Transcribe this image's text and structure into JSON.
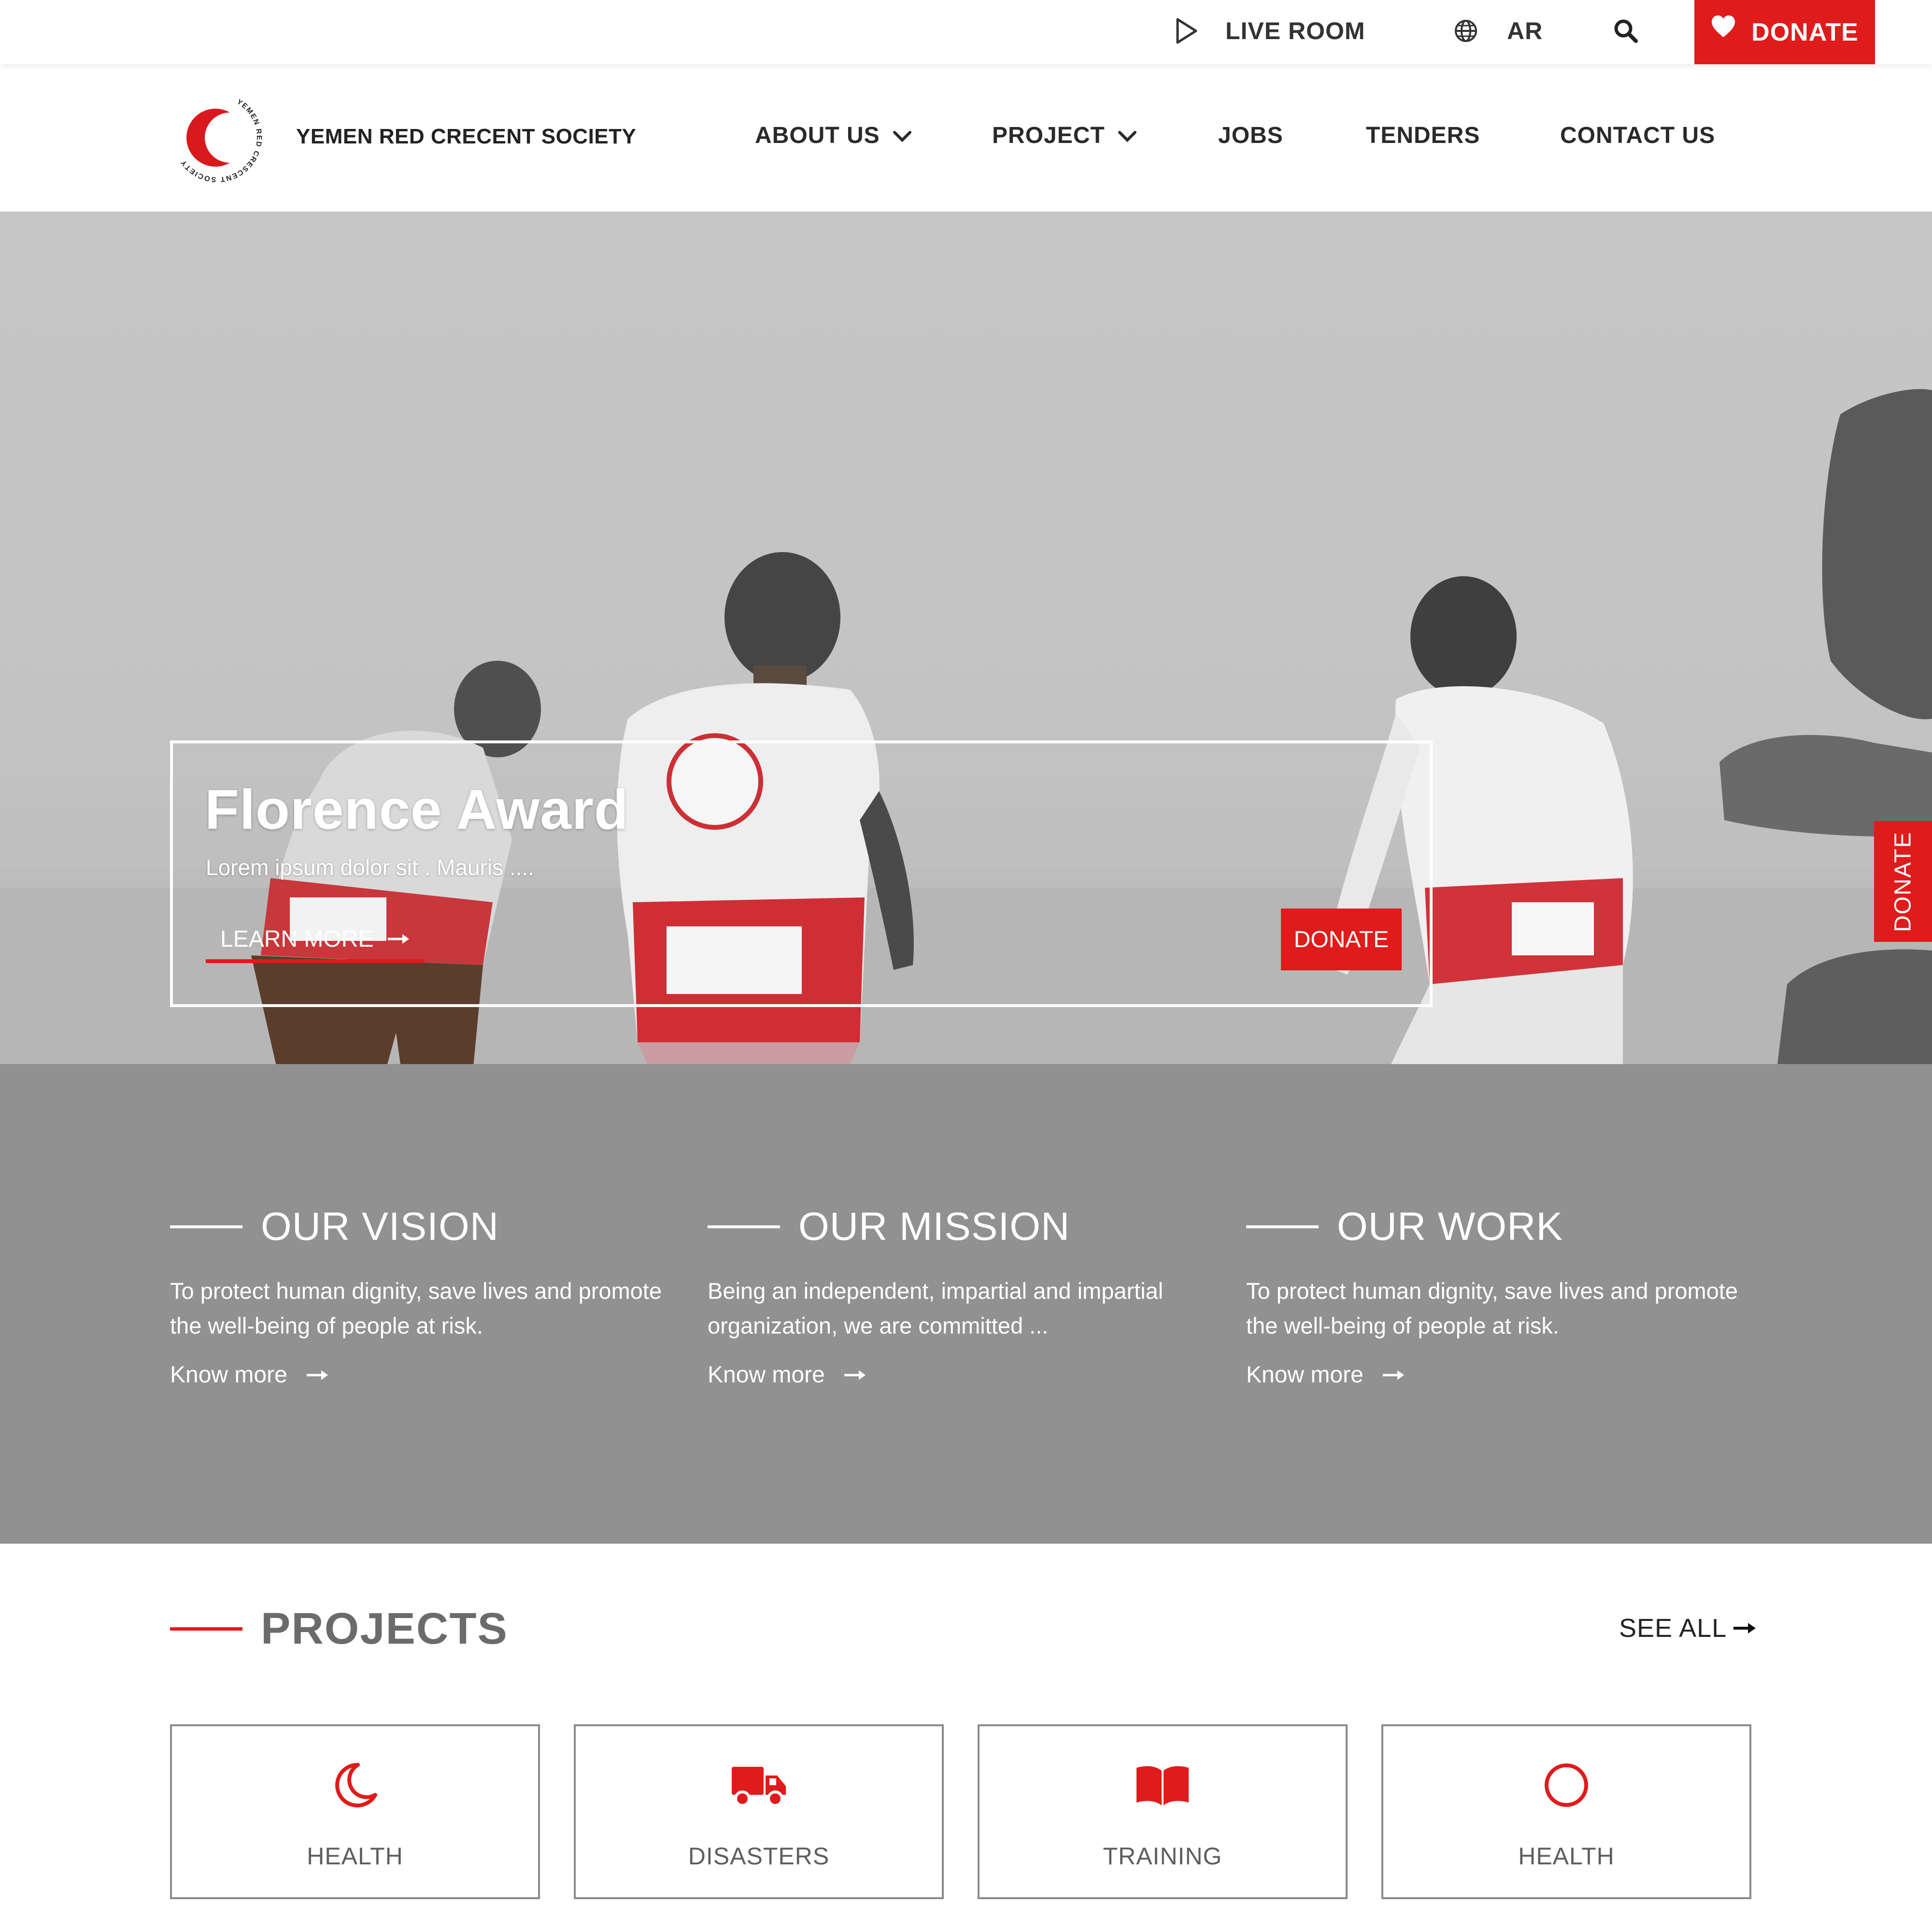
{
  "topbar": {
    "live_room": "LIVE ROOM",
    "language": "AR",
    "donate": "DONATE"
  },
  "header": {
    "brand": "YEMEN RED CRECENT SOCIETY",
    "logo_text": "YEMEN RED CRESCENT SOCIETY",
    "nav": {
      "about": "ABOUT US",
      "project": "PROJECT",
      "jobs": "JOBS",
      "tenders": "TENDERS",
      "contact": "CONTACT US"
    }
  },
  "hero": {
    "title": "Florence Award",
    "subtitle": "Lorem ipsum dolor sit . Mauris ....",
    "learn_more": "LEARN MORE",
    "donate": "DONATE",
    "side_donate": "DONATE"
  },
  "pillars": {
    "vision": {
      "title": "OUR VISION",
      "text": "To protect human dignity, save lives and promote the well-being of people at risk.",
      "more": "Know more"
    },
    "mission": {
      "title": "OUR MISSION",
      "text": "Being an independent, impartial and impartial organization, we are committed ...",
      "more": "Know more"
    },
    "work": {
      "title": "OUR WORK",
      "text": "To protect human dignity, save lives and promote the well-being of people at risk.",
      "more": "Know more"
    }
  },
  "projects": {
    "title": "PROJECTS",
    "see_all": "SEE ALL",
    "cards": [
      {
        "label": "HEALTH",
        "icon": "crescent-moon-icon"
      },
      {
        "label": "DISASTERS",
        "icon": "truck-icon"
      },
      {
        "label": "TRAINING",
        "icon": "open-book-icon"
      },
      {
        "label": "HEALTH",
        "icon": "circle-icon"
      }
    ]
  },
  "colors": {
    "accent": "#e01b1b",
    "pillars_bg": "#919191",
    "hero_bg": "#c4c4c4"
  }
}
